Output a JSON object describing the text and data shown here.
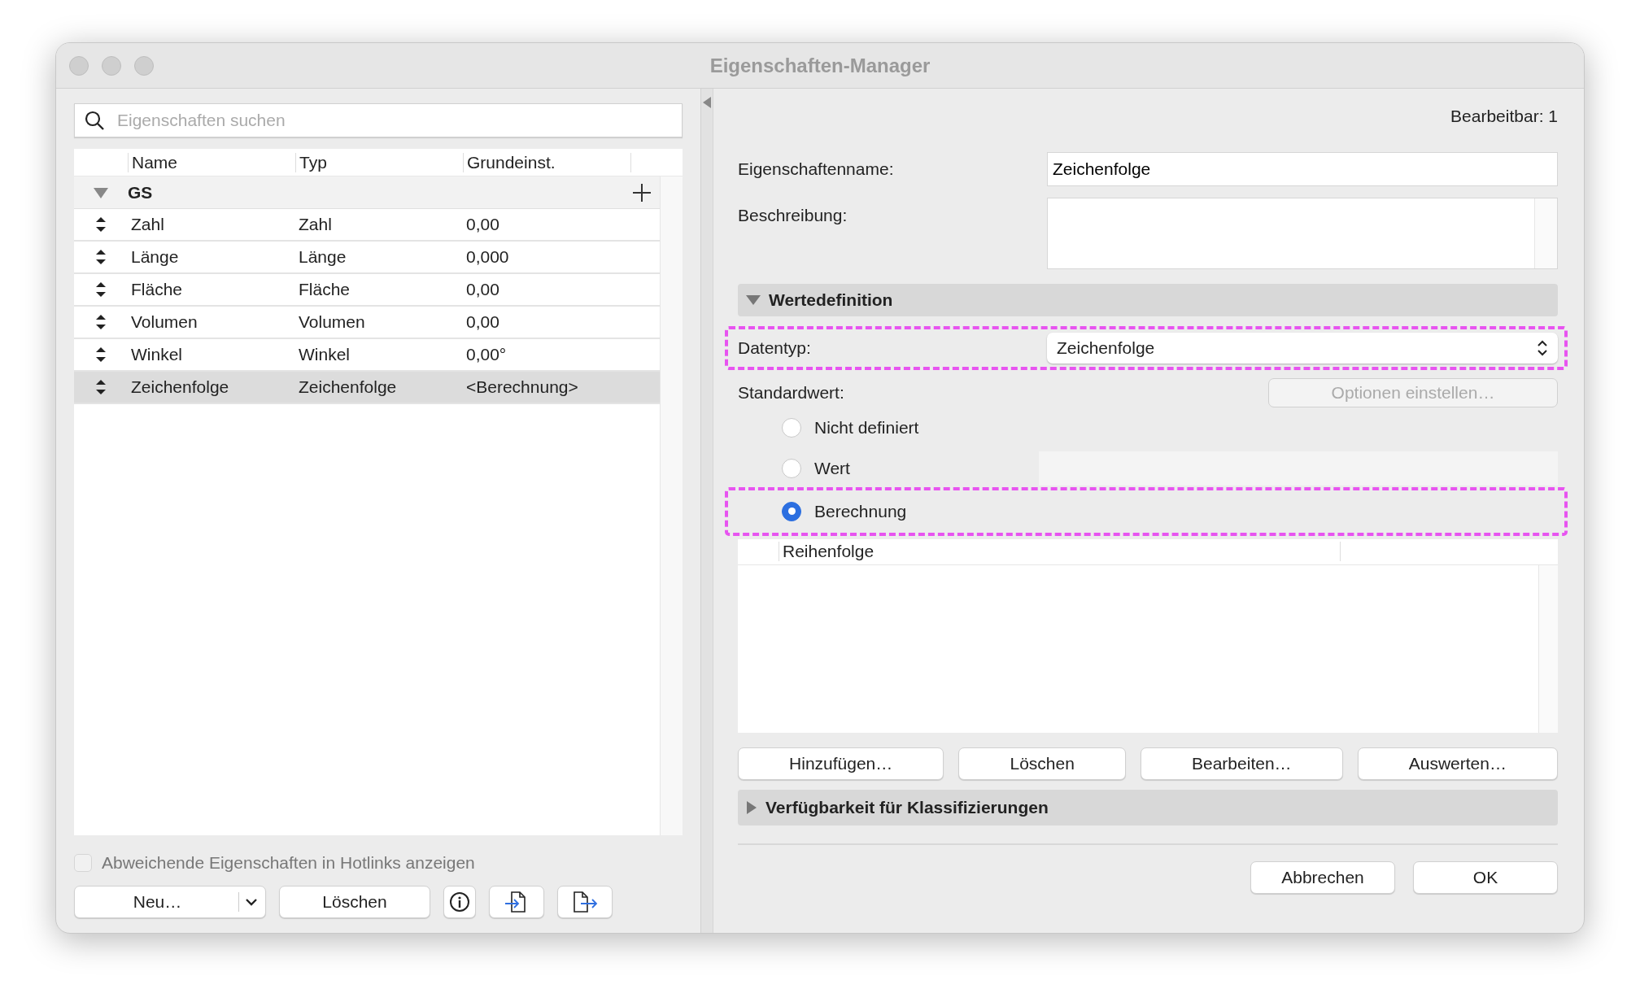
{
  "window": {
    "title": "Eigenschaften-Manager"
  },
  "search": {
    "placeholder": "Eigenschaften suchen"
  },
  "table": {
    "columns": [
      "Name",
      "Typ",
      "Grundeinst."
    ],
    "group": {
      "label": "GS",
      "expanded": true
    },
    "rows": [
      {
        "cells": [
          "Zahl",
          "Zahl",
          "0,00"
        ],
        "selected": false
      },
      {
        "cells": [
          "Länge",
          "Länge",
          "0,000"
        ],
        "selected": false
      },
      {
        "cells": [
          "Fläche",
          "Fläche",
          "0,00"
        ],
        "selected": false
      },
      {
        "cells": [
          "Volumen",
          "Volumen",
          "0,00"
        ],
        "selected": false
      },
      {
        "cells": [
          "Winkel",
          "Winkel",
          "0,00°"
        ],
        "selected": false
      },
      {
        "cells": [
          "Zeichenfolge",
          "Zeichenfolge",
          "<Berechnung>"
        ],
        "selected": true
      }
    ]
  },
  "hotlinks_checkbox": {
    "label": "Abweichende Eigenschaften in Hotlinks anzeigen",
    "checked": false,
    "disabled": true
  },
  "left_buttons": [
    {
      "kind": "split",
      "label": "Neu…"
    },
    {
      "kind": "text",
      "label": "Löschen"
    },
    {
      "kind": "info"
    },
    {
      "kind": "import"
    },
    {
      "kind": "export"
    }
  ],
  "editable": "Bearbeitbar: 1",
  "name_field": {
    "label": "Eigenschaftenname:",
    "value": "Zeichenfolge"
  },
  "description_field": {
    "label": "Beschreibung:"
  },
  "value_section": {
    "title": "Wertedefinition",
    "expanded": true
  },
  "datatype": {
    "label": "Datentyp:",
    "value": "Zeichenfolge",
    "highlighted": true
  },
  "default_value": {
    "label": "Standardwert:",
    "options_button": {
      "label": "Optionen einstellen…",
      "disabled": true
    },
    "radios": [
      {
        "label": "Nicht definiert",
        "kind": "plain",
        "selected": false,
        "highlighted": false
      },
      {
        "label": "Wert",
        "kind": "field",
        "selected": false,
        "highlighted": false
      },
      {
        "label": "Berechnung",
        "kind": "plain",
        "selected": true,
        "highlighted": true
      }
    ]
  },
  "order_list": {
    "column": "Reihenfolge"
  },
  "list_buttons": [
    "Hinzufügen…",
    "Löschen",
    "Bearbeiten…",
    "Auswerten…"
  ],
  "classification_section": {
    "title": "Verfügbarkeit für Klassifizierungen",
    "expanded": false
  },
  "footer_buttons": [
    {
      "label": "Abbrechen",
      "default": false
    },
    {
      "label": "OK",
      "default": false
    }
  ]
}
